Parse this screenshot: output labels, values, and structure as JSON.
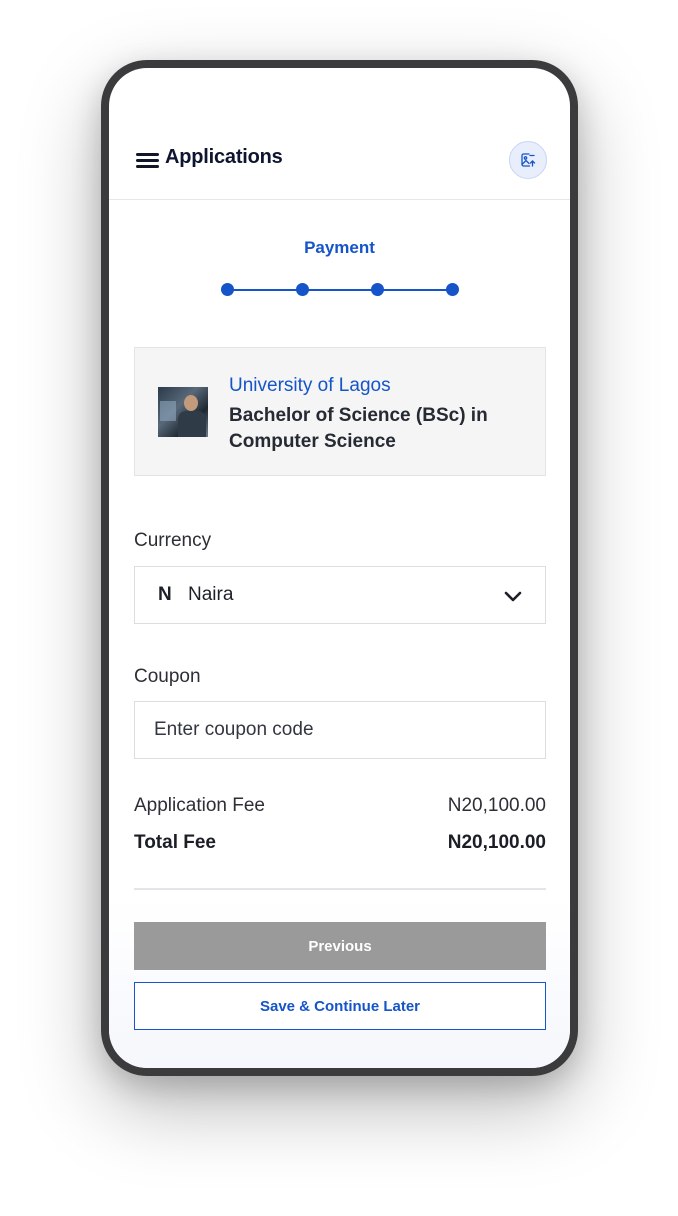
{
  "header": {
    "title": "Applications",
    "menu_icon": "hamburger-menu-icon",
    "upload_icon": "image-upload-icon"
  },
  "stepper": {
    "current_step_label": "Payment",
    "total_steps": 4,
    "active_color": "#1554c9"
  },
  "program_card": {
    "university": "University of Lagos",
    "program": "Bachelor of Science (BSc) in Computer Science"
  },
  "form": {
    "currency": {
      "label": "Currency",
      "symbol": "N",
      "value": "Naira",
      "icon": "chevron-down-icon"
    },
    "coupon": {
      "label": "Coupon",
      "placeholder": "Enter coupon code",
      "value": ""
    }
  },
  "fees": {
    "application_fee_label": "Application Fee",
    "application_fee_amount": "N20,100.00",
    "total_fee_label": "Total Fee",
    "total_fee_amount": "N20,100.00"
  },
  "footer": {
    "previous_label": "Previous",
    "save_later_label": "Save & Continue Later"
  },
  "colors": {
    "brand": "#1554c9",
    "disabled_button": "#9a9a9a"
  }
}
